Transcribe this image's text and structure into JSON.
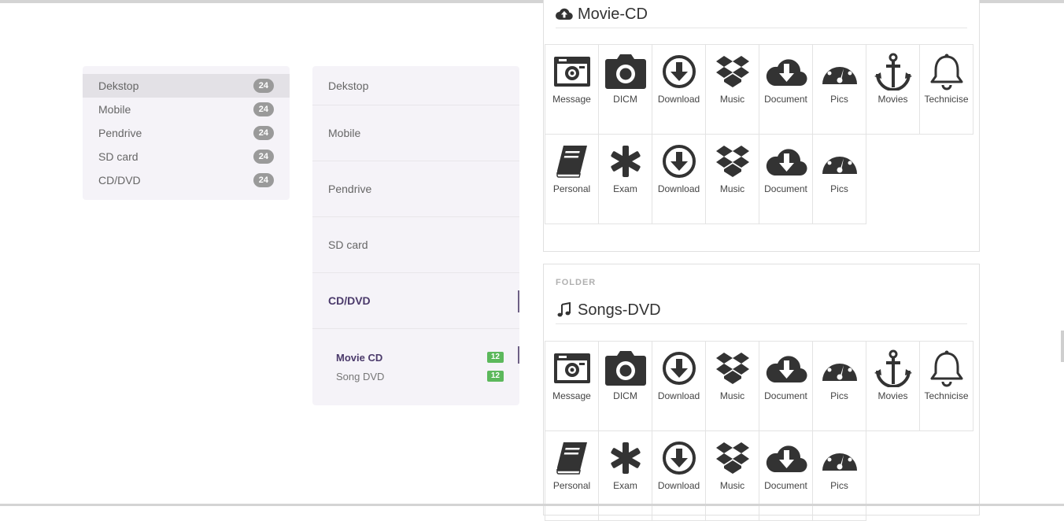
{
  "list1": {
    "items": [
      {
        "label": "Dekstop",
        "count": "24"
      },
      {
        "label": "Mobile",
        "count": "24"
      },
      {
        "label": "Pendrive",
        "count": "24"
      },
      {
        "label": "SD card",
        "count": "24"
      },
      {
        "label": "CD/DVD",
        "count": "24"
      }
    ]
  },
  "list2": {
    "items": [
      {
        "label": "Dekstop"
      },
      {
        "label": "Mobile"
      },
      {
        "label": "Pendrive"
      },
      {
        "label": "SD card"
      },
      {
        "label": "CD/DVD"
      }
    ],
    "subitems": [
      {
        "label": "Movie CD",
        "count": "12"
      },
      {
        "label": "Song DVD",
        "count": "12"
      }
    ]
  },
  "panel1": {
    "title": "Movie-CD",
    "title_icon": "cloud-upload-icon",
    "tiles": [
      {
        "label": "Message",
        "icon": "message-icon"
      },
      {
        "label": "DICM",
        "icon": "camera-icon"
      },
      {
        "label": "Download",
        "icon": "download-icon"
      },
      {
        "label": "Music",
        "icon": "dropbox-icon"
      },
      {
        "label": "Document",
        "icon": "cloud-download-icon"
      },
      {
        "label": "Pics",
        "icon": "dashboard-icon"
      },
      {
        "label": "Movies",
        "icon": "anchor-icon"
      },
      {
        "label": "Technicise",
        "icon": "bell-icon"
      },
      {
        "label": "Personal",
        "icon": "book-icon"
      },
      {
        "label": "Exam",
        "icon": "asterisk-icon"
      },
      {
        "label": "Download",
        "icon": "download-icon"
      },
      {
        "label": "Music",
        "icon": "dropbox-icon"
      },
      {
        "label": "Document",
        "icon": "cloud-download-icon"
      },
      {
        "label": "Pics",
        "icon": "dashboard-icon"
      }
    ]
  },
  "panel2": {
    "label": "FOLDER",
    "title": "Songs-DVD",
    "title_icon": "music-note-icon",
    "tiles": [
      {
        "label": "Message",
        "icon": "message-icon"
      },
      {
        "label": "DICM",
        "icon": "camera-icon"
      },
      {
        "label": "Download",
        "icon": "download-icon"
      },
      {
        "label": "Music",
        "icon": "dropbox-icon"
      },
      {
        "label": "Document",
        "icon": "cloud-download-icon"
      },
      {
        "label": "Pics",
        "icon": "dashboard-icon"
      },
      {
        "label": "Movies",
        "icon": "anchor-icon"
      },
      {
        "label": "Technicise",
        "icon": "bell-icon"
      },
      {
        "label": "Personal",
        "icon": "book-icon"
      },
      {
        "label": "Exam",
        "icon": "asterisk-icon"
      },
      {
        "label": "Download",
        "icon": "download-icon"
      },
      {
        "label": "Music",
        "icon": "dropbox-icon"
      },
      {
        "label": "Document",
        "icon": "cloud-download-icon"
      },
      {
        "label": "Pics",
        "icon": "dashboard-icon"
      }
    ]
  },
  "colors": {
    "list_bg": "#f5f3f8",
    "active_bg": "#e3e1e6",
    "badge_grey": "#9a9a9a",
    "badge_green": "#5cb85c",
    "accent_purple": "#4b3a6b",
    "icon_dark": "#333333"
  }
}
